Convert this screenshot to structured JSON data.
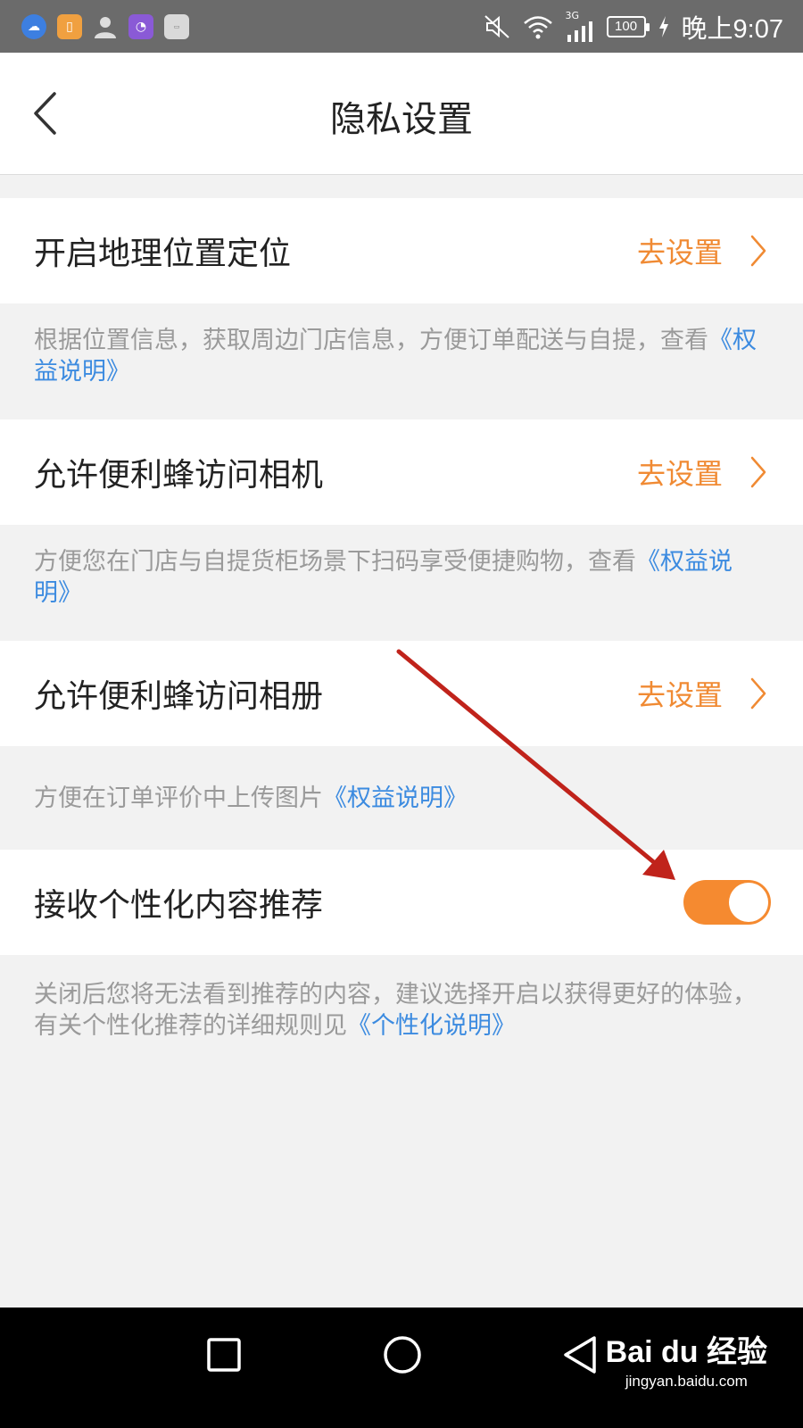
{
  "status_bar": {
    "battery": "100",
    "network": "3G",
    "time": "晚上9:07"
  },
  "header": {
    "title": "隐私设置"
  },
  "settings": [
    {
      "label": "开启地理位置定位",
      "action": "去设置",
      "desc_text": "根据位置信息，获取周边门店信息，方便订单配送与自提，查看",
      "desc_link": "《权益说明》"
    },
    {
      "label": "允许便利蜂访问相机",
      "action": "去设置",
      "desc_text": "方便您在门店与自提货柜场景下扫码享受便捷购物，查看",
      "desc_link": "《权益说明》"
    },
    {
      "label": "允许便利蜂访问相册",
      "action": "去设置",
      "desc_text": "方便在订单评价中上传图片",
      "desc_link": "《权益说明》"
    },
    {
      "label": "接收个性化内容推荐",
      "toggle_on": true,
      "desc_text": "关闭后您将无法看到推荐的内容，建议选择开启以获得更好的体验，有关个性化推荐的详细规则见",
      "desc_link": "《个性化说明》"
    }
  ],
  "colors": {
    "accent": "#f08a33",
    "link": "#3c8be0",
    "toggle": "#f58a30",
    "annotation": "#c0231b"
  },
  "watermark": {
    "logo": "Bai du 经验",
    "sub": "jingyan.baidu.com"
  }
}
